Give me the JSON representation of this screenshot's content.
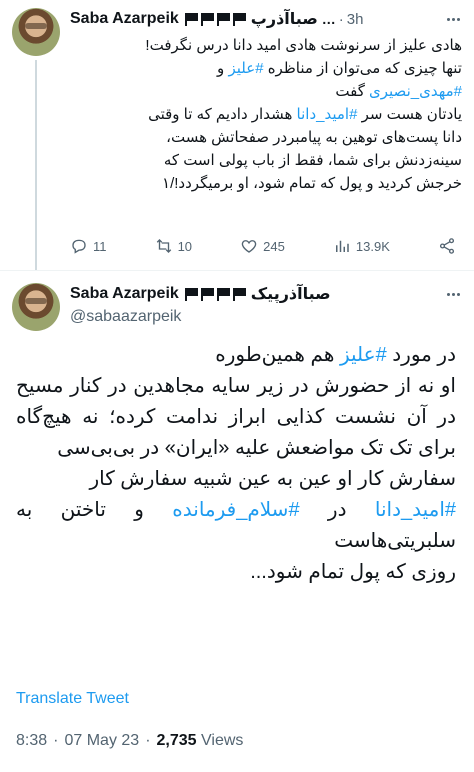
{
  "tweet1": {
    "author_name": "Saba Azarpeik",
    "author_name_rtl": "صباآذرپ",
    "name_truncation": "…",
    "time": "3h",
    "body_lines": [
      "هادی علیز از سرنوشت هادی امید دانا درس نگرفت!",
      "تنها چیزی که می‌توان از مناظره",
      "گفت",
      "یادتان هست سر",
      "هشدار دادیم که تا وقتی",
      "دانا پست‌های توهین به پیامبردر صفحاتش هست،",
      "سینه‌زدنش برای شما، فقط از باب پولی است که",
      "خرجش کردید و پول که تمام شود، او برمیگردد!/۱"
    ],
    "hashtags": {
      "alizz": "#علیز",
      "and": "و",
      "mahdi": "#مهدی_نصیری",
      "omid": "#امید_دانا"
    },
    "metrics": {
      "replies": "11",
      "retweets": "10",
      "likes": "245",
      "views": "13.9K"
    }
  },
  "tweet2": {
    "author_name": "Saba Azarpeik",
    "author_name_rtl": "صباآذرپیک",
    "handle": "@sabaazarpeik",
    "line1_a": "در مورد",
    "line1_tag": "#علیز",
    "line1_b": "هم همین‌طوره",
    "para2": "او نه از حضورش در زیر سایه مجاهدین در کنار مسیح در آن نشست کذایی ابراز ندامت کرده؛ نه هیچ‌گاه برای تک تک مواضعش علیه «ایران» در بی‌بی‌سی",
    "line3": "سفارش کار او عین به عین شبیه سفارش کار",
    "tag_omid": "#امید_دانا",
    "in_word": "در",
    "tag_salam": "#سلام_فرمانده",
    "line4_tail": "و تاختن به سلبریتی‌هاست",
    "line5": "روزی که پول تمام شود..."
  },
  "translate_label": "Translate Tweet",
  "meta": {
    "time": "8:38",
    "date": "07 May 23",
    "views_count": "2,735",
    "views_label": "Views"
  },
  "colors": {
    "accent": "#1d9bf0",
    "text": "#0f1419",
    "secondary": "#536471",
    "divider": "#eff3f4"
  }
}
